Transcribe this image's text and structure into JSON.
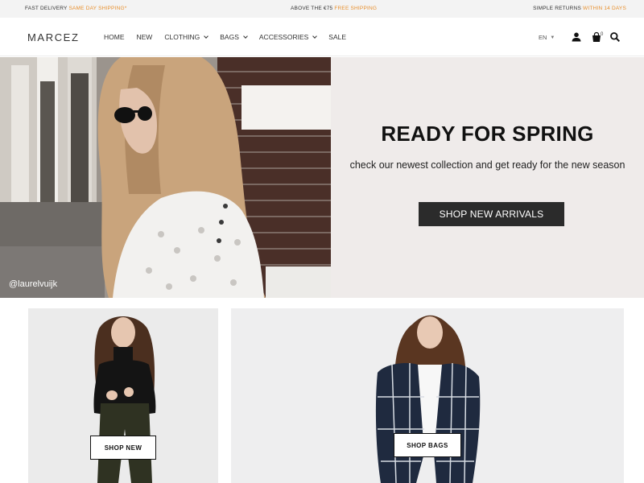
{
  "promo_bar": {
    "left_text": "FAST DELIVERY",
    "left_highlight": "SAME DAY SHIPPING*",
    "mid_text": "ABOVE THE €75",
    "mid_highlight": "FREE SHIPPING",
    "right_text": "SIMPLE RETURNS",
    "right_highlight": "WITHIN 14 DAYS",
    "highlight_color": "#e8902e"
  },
  "header": {
    "logo": "MARCEZ",
    "nav": [
      {
        "label": "HOME",
        "has_dropdown": false
      },
      {
        "label": "NEW",
        "has_dropdown": false
      },
      {
        "label": "CLOTHING",
        "has_dropdown": true
      },
      {
        "label": "BAGS",
        "has_dropdown": true
      },
      {
        "label": "ACCESSORIES",
        "has_dropdown": true
      },
      {
        "label": "SALE",
        "has_dropdown": false
      }
    ],
    "language": "EN",
    "cart_count": "0",
    "icons": [
      "user-icon",
      "cart-icon",
      "search-icon"
    ]
  },
  "hero": {
    "title": "READY FOR SPRING",
    "subtitle": "check our newest collection and get ready for the new season",
    "cta_label": "SHOP NEW ARRIVALS",
    "photo_credit": "@laurelvuijk",
    "cta_color": "#2b2b2b",
    "background_color": "#efebea"
  },
  "tiles": [
    {
      "button_label": "SHOP NEW"
    },
    {
      "button_label": "SHOP BAGS"
    }
  ]
}
